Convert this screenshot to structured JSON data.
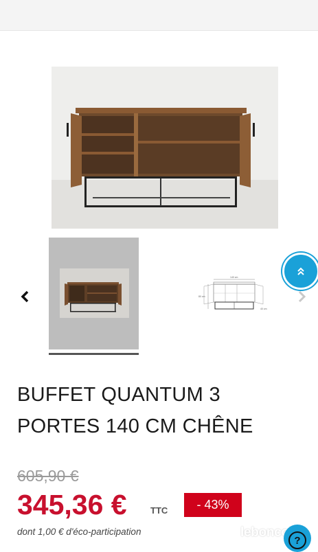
{
  "product": {
    "title_line1": "BUFFET QUANTUM 3",
    "title_line2": "PORTES 140 CM CHÊNE",
    "old_price": "605,90 €",
    "price": "345,36 €",
    "price_suffix": "TTC",
    "discount": "- 43%",
    "eco_participation": "dont 1,00 € d'éco-participation"
  },
  "gallery": {
    "prev_icon": "chevron-left-icon",
    "next_icon": "chevron-right-icon",
    "dimension_labels": [
      "140 cm",
      "80 cm",
      "40 cm"
    ]
  },
  "overlay": {
    "brand": "leboncoin",
    "scroll_top_icon": "double-chevron-up-icon",
    "help_label": "?"
  },
  "colors": {
    "accent_blue": "#1aa1d8",
    "price_red": "#c8102e",
    "discount_red": "#d0021b"
  }
}
